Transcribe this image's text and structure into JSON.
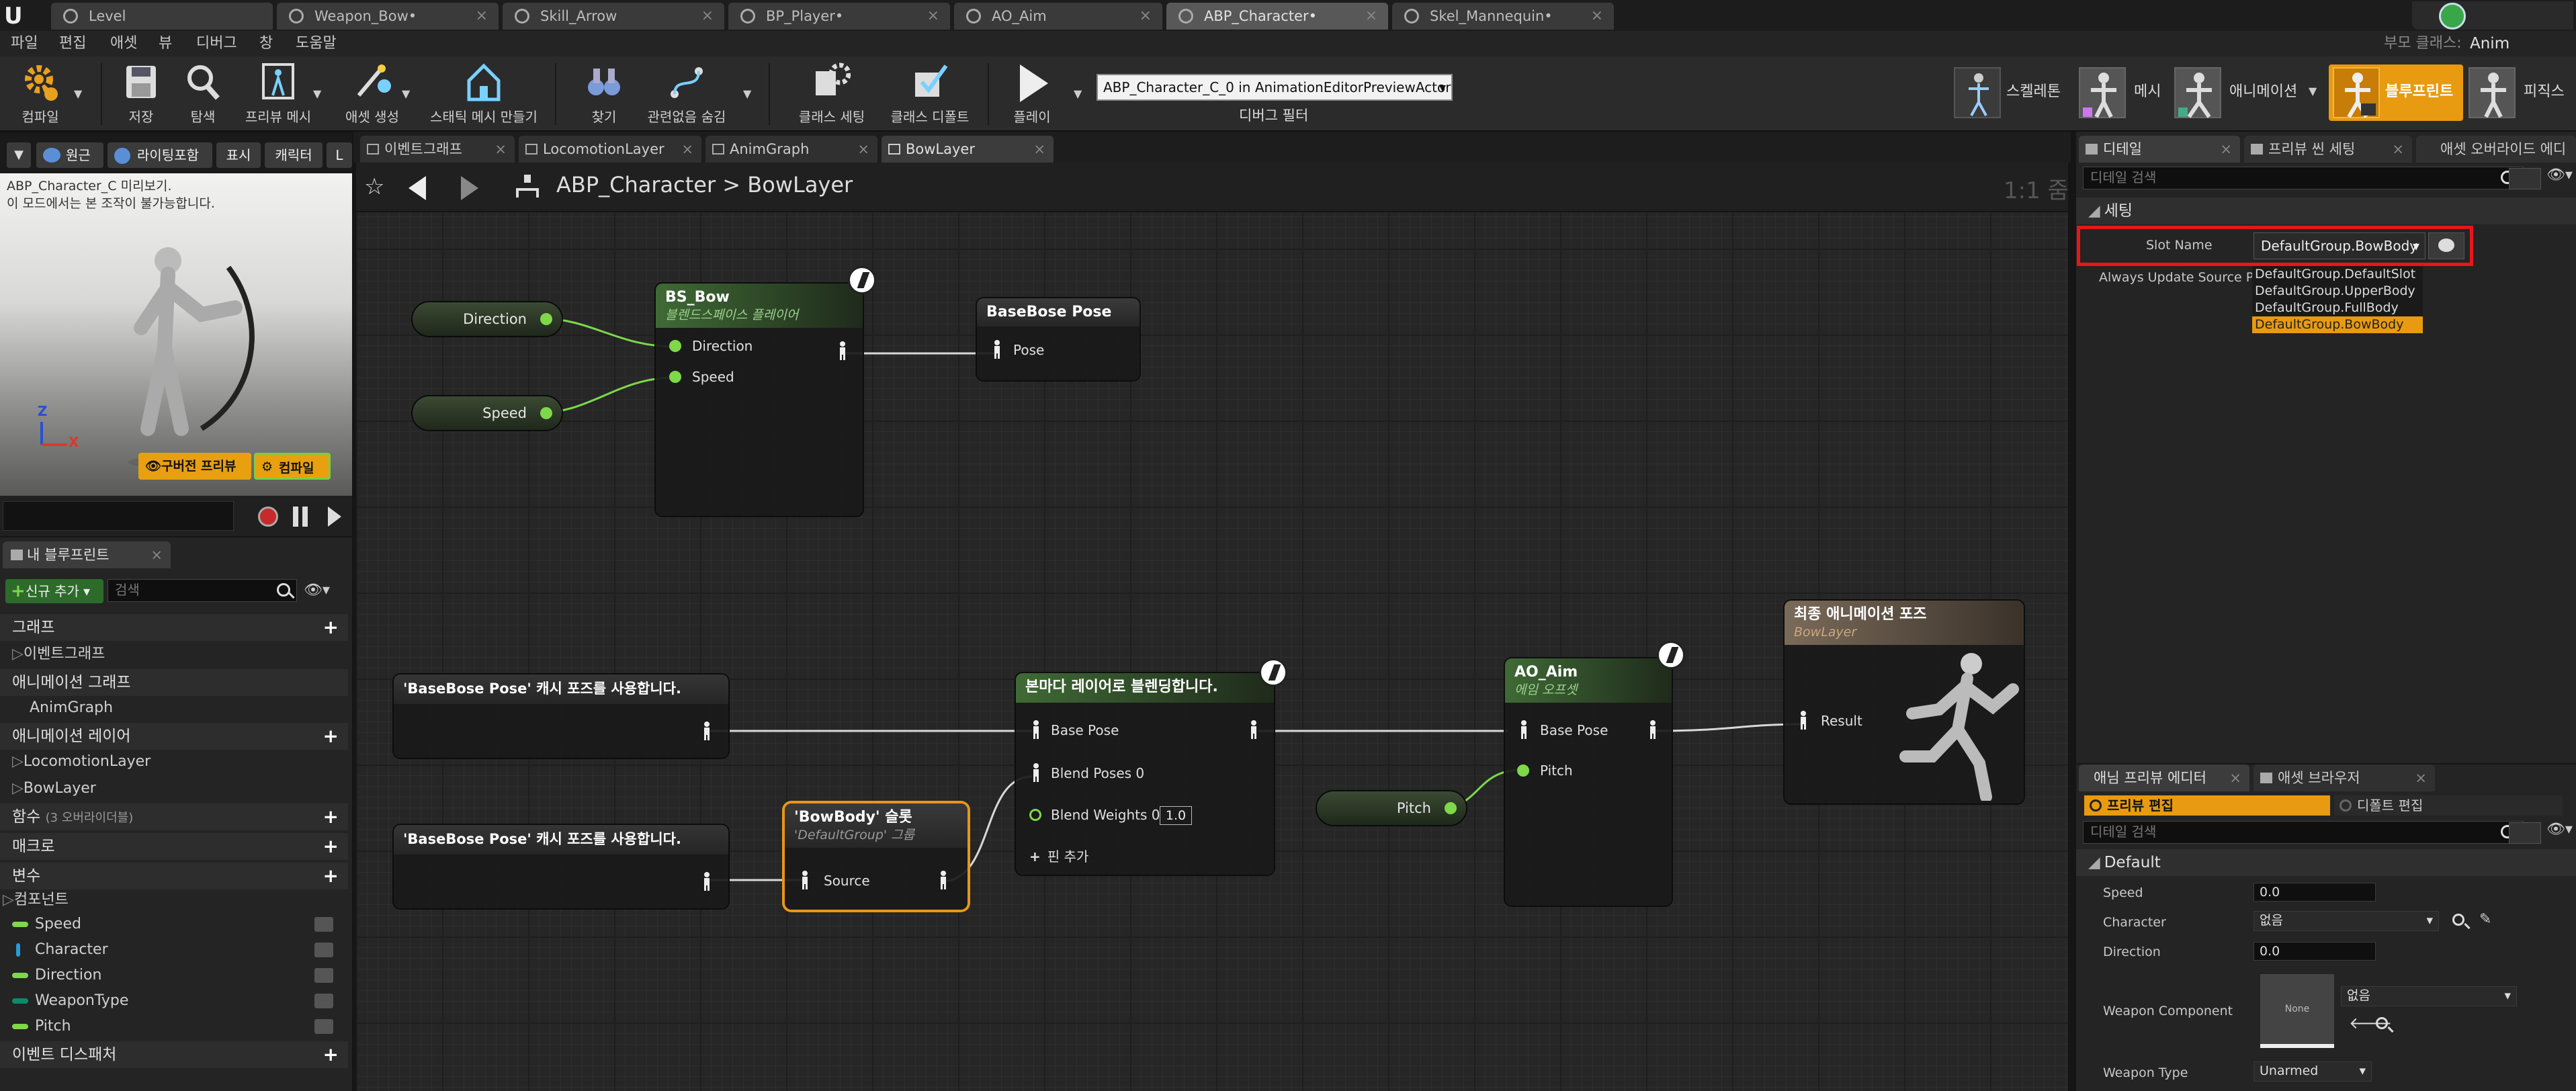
{
  "titlebar": {
    "logo": "U",
    "tabs": [
      {
        "label": "Level"
      },
      {
        "label": "Weapon_Bow•"
      },
      {
        "label": "Skill_Arrow"
      },
      {
        "label": "BP_Player•"
      },
      {
        "label": "AO_Aim"
      },
      {
        "label": "ABP_Character•"
      },
      {
        "label": "Skel_Mannequin•"
      }
    ]
  },
  "menubar": {
    "items": [
      "파일",
      "편집",
      "애셋",
      "뷰",
      "디버그",
      "창",
      "도움말"
    ],
    "parent_class_label": "부모 클래스:",
    "parent_class_value": "Anim Instance"
  },
  "toolbar": {
    "buttons": [
      "컴파일",
      "저장",
      "탐색",
      "프리뷰 메시",
      "애셋 생성",
      "스태틱 메시 만들기",
      "찾기",
      "관련없음 숨김",
      "클래스 세팅",
      "클래스 디폴트",
      "플레이"
    ],
    "debug_object": "ABP_Character_C_0 in AnimationEditorPreviewActor",
    "debug_filter_label": "디버그 필터",
    "modes": [
      "스켈레톤",
      "메시",
      "애니메이션",
      "블루프린트",
      "피직스"
    ]
  },
  "viewport": {
    "toolbar": [
      "원근",
      "라이팅포함",
      "표시",
      "캐릭터",
      "L"
    ],
    "info_line1": "ABP_Character_C 미리보기.",
    "info_line2": "이 모드에서는 본 조작이 불가능합니다.",
    "preview_button": "구버전 프리뷰",
    "compile_button": "컴파일",
    "axis_z": "Z",
    "axis_x": "X"
  },
  "my_blueprint": {
    "tab": "내 블루프린트",
    "add_new": "신규 추가",
    "search_placeholder": "검색",
    "sections": {
      "graphs": "그래프",
      "event_graph": "이벤트그래프",
      "anim_graphs": "애니메이션 그래프",
      "anim_graph": "AnimGraph",
      "anim_layers": "애니메이션 레이어",
      "locomotion_layer": "LocomotionLayer",
      "bow_layer": "BowLayer",
      "functions": "함수",
      "functions_override": "(3 오버라이더블)",
      "macros": "매크로",
      "variables": "변수",
      "components": "컴포넌트",
      "event_dispatchers": "이벤트 디스패처"
    },
    "variables": [
      {
        "name": "Speed",
        "color": "#7ed84a"
      },
      {
        "name": "Character",
        "color": "#2a9ad8"
      },
      {
        "name": "Direction",
        "color": "#7ed84a"
      },
      {
        "name": "WeaponType",
        "color": "#0d8a6a"
      },
      {
        "name": "Pitch",
        "color": "#7ed84a"
      }
    ]
  },
  "graph": {
    "tabs": [
      "이벤트그래프",
      "LocomotionLayer",
      "AnimGraph",
      "BowLayer"
    ],
    "breadcrumb_root": "ABP_Character",
    "breadcrumb_sep": ">",
    "breadcrumb_leaf": "BowLayer",
    "zoom": "1:1 줌",
    "nodes": {
      "var_direction": "Direction",
      "var_speed": "Speed",
      "var_pitch": "Pitch",
      "bs_bow_title": "BS_Bow",
      "bs_bow_sub": "블렌드스페이스 플레이어",
      "bs_bow_pin_direction": "Direction",
      "bs_bow_pin_speed": "Speed",
      "basebose_title": "BaseBose Pose",
      "basebose_pin": "Pose",
      "cache1": "'BaseBose Pose' 캐시 포즈를 사용합니다.",
      "cache2": "'BaseBose Pose' 캐시 포즈를 사용합니다.",
      "slot_title": "'BowBody' 슬롯",
      "slot_sub": "'DefaultGroup' 그룹",
      "slot_pin": "Source",
      "layer_blend_title": "본마다 레이어로 블렌딩합니다.",
      "layer_pin_base": "Base Pose",
      "layer_pin_blend": "Blend Poses 0",
      "layer_pin_weights": "Blend Weights 0",
      "layer_weight_value": "1.0",
      "layer_add_pin": "핀 추가",
      "ao_title": "AO_Aim",
      "ao_sub": "에임 오프셋",
      "ao_pin_base": "Base Pose",
      "ao_pin_pitch": "Pitch",
      "final_title": "최종 애니메이션 포즈",
      "final_sub": "BowLayer",
      "final_pin": "Result"
    }
  },
  "details": {
    "tabs": [
      "디테일",
      "프리뷰 씬 세팅",
      "애셋 오버라이드 에디"
    ],
    "search_placeholder": "디테일 검색",
    "section": "세팅",
    "slot_name_label": "Slot Name",
    "slot_name_value": "DefaultGroup.BowBody",
    "always_update_label": "Always Update Source Po",
    "dropdown_options": [
      "DefaultGroup.DefaultSlot",
      "DefaultGroup.UpperBody",
      "DefaultGroup.FullBody",
      "DefaultGroup.BowBody"
    ],
    "highlight_color": "#e8161a"
  },
  "preview_editor": {
    "tabs": [
      "애님 프리뷰 에디터",
      "애셋 브라우저"
    ],
    "mode_edit_preview": "프리뷰 편집",
    "mode_edit_defaults": "디폴트 편집",
    "search_placeholder": "디테일 검색",
    "section": "Default",
    "fields": {
      "speed_label": "Speed",
      "speed_value": "0.0",
      "character_label": "Character",
      "character_value": "없음",
      "direction_label": "Direction",
      "direction_value": "0.0",
      "weapon_component_label": "Weapon Component",
      "weapon_thumb": "None",
      "weapon_component_value": "없음",
      "weapon_type_label": "Weapon Type",
      "weapon_type_value": "Unarmed"
    }
  },
  "colors": {
    "accent_orange": "#e89a10",
    "pin_green": "#7ed84a"
  }
}
